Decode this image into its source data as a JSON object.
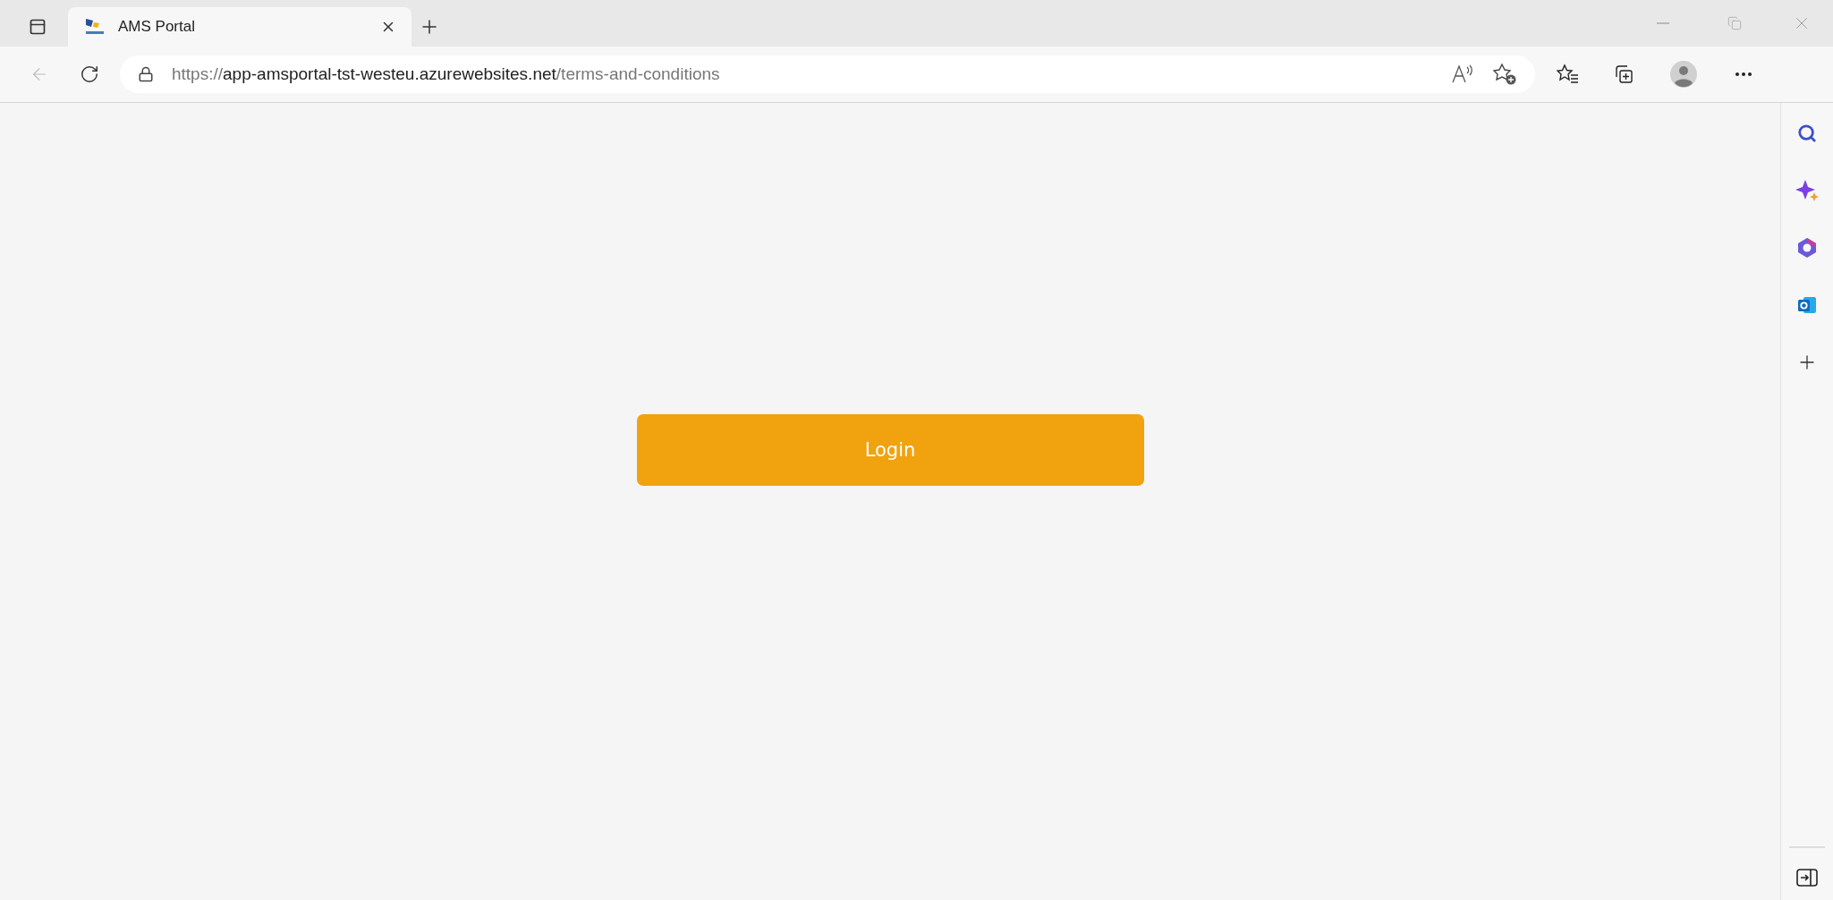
{
  "tabs": [
    {
      "title": "AMS Portal",
      "selected": true
    }
  ],
  "address_bar": {
    "scheme": "https://",
    "host": "app-amsportal-tst-westeu.azurewebsites.net",
    "path": "/terms-and-conditions"
  },
  "page": {
    "login_button": "Login"
  }
}
